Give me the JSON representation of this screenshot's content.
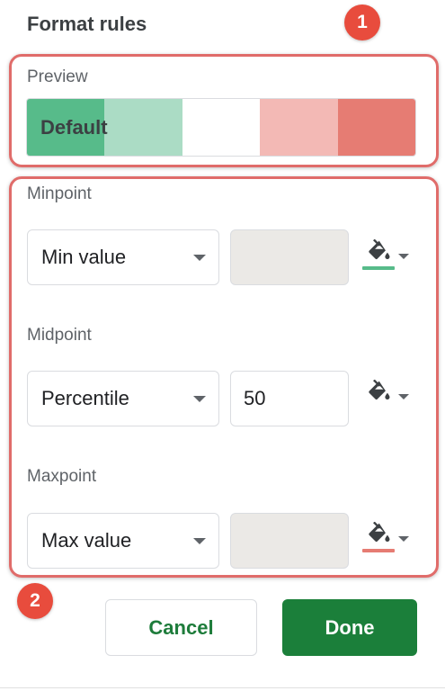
{
  "panel": {
    "title": "Format rules"
  },
  "annotations": {
    "badge_1": "1",
    "badge_2": "2",
    "color": "#e84c3d"
  },
  "preview": {
    "label": "Preview",
    "text": "Default",
    "gradient_colors": [
      "#57bb8a",
      "#abdcc5",
      "#ffffff",
      "#f3b9b5",
      "#e67c73"
    ]
  },
  "minpoint": {
    "label": "Minpoint",
    "type": "Min value",
    "value": "",
    "value_disabled": true,
    "fill_icon": "fill-color-icon",
    "color": "#57bb8a"
  },
  "midpoint": {
    "label": "Midpoint",
    "type": "Percentile",
    "value": "50",
    "value_disabled": false,
    "fill_icon": "fill-color-icon",
    "color": null
  },
  "maxpoint": {
    "label": "Maxpoint",
    "type": "Max value",
    "value": "",
    "value_disabled": true,
    "fill_icon": "fill-color-icon",
    "color": "#e67c73"
  },
  "actions": {
    "cancel_label": "Cancel",
    "done_label": "Done",
    "accent": "#1b7f3a"
  }
}
